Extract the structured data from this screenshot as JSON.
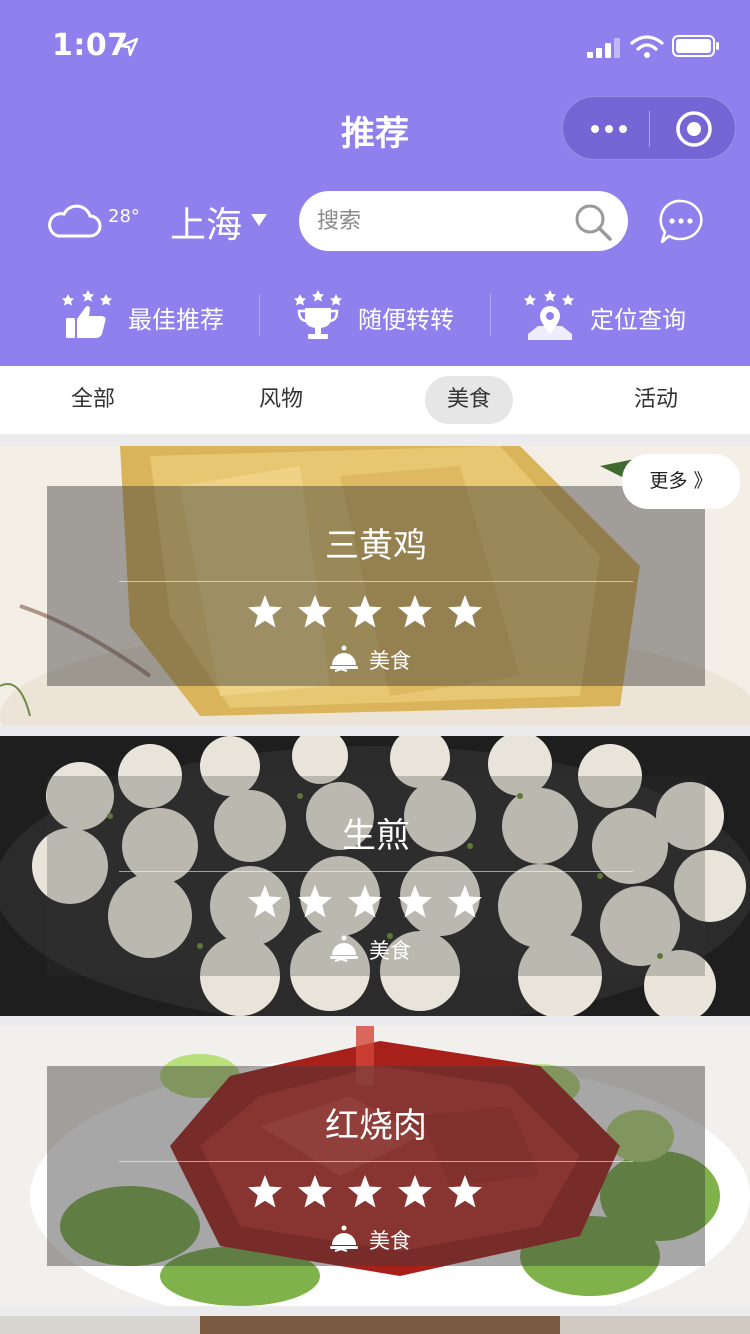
{
  "status_bar": {
    "time": "1:07"
  },
  "nav": {
    "title": "推荐"
  },
  "header": {
    "temperature": "28°",
    "city": "上海",
    "search": {
      "placeholder": "搜索"
    }
  },
  "quick_nav": [
    {
      "label": "最佳推荐",
      "icon": "thumbs-up-stars-icon"
    },
    {
      "label": "随便转转",
      "icon": "trophy-stars-icon"
    },
    {
      "label": "定位查询",
      "icon": "map-pin-stars-icon"
    }
  ],
  "tabs": [
    {
      "label": "全部",
      "active": false
    },
    {
      "label": "风物",
      "active": false
    },
    {
      "label": "美食",
      "active": true
    },
    {
      "label": "活动",
      "active": false
    }
  ],
  "cards": [
    {
      "name": "三黄鸡",
      "rating": 5,
      "category": "美食"
    },
    {
      "name": "生煎",
      "rating": 5,
      "category": "美食"
    },
    {
      "name": "红烧肉",
      "rating": 5,
      "category": "美食"
    }
  ],
  "more_button": "更多 》",
  "colors": {
    "header": "#8f80ee",
    "tab_active_bg": "#e6e6e6"
  }
}
